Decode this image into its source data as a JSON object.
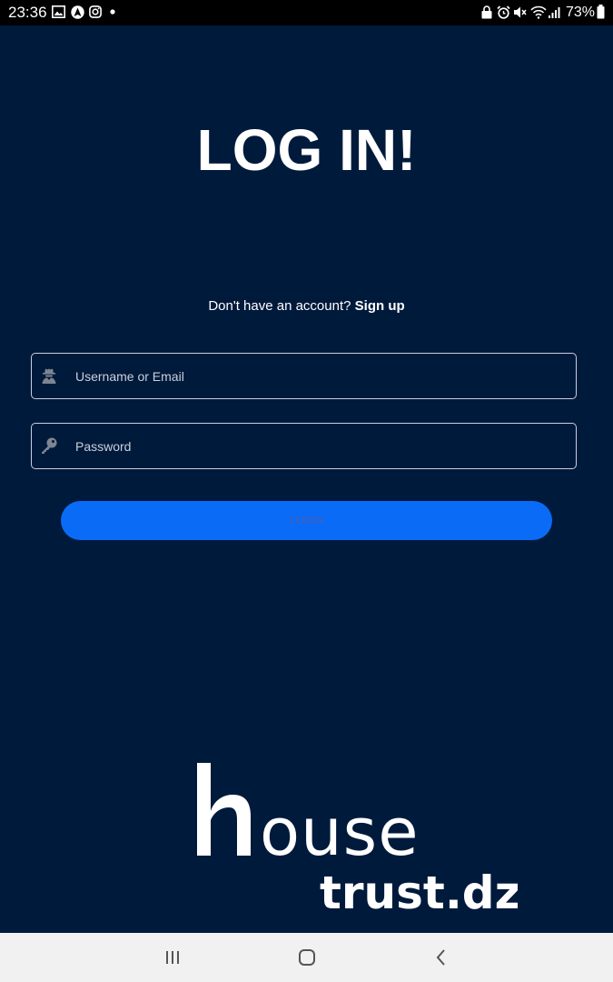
{
  "status_bar": {
    "time": "23:36",
    "battery_percent": "73%",
    "left_icons": [
      "gallery-icon",
      "android-auto-icon",
      "instagram-icon",
      "dot-icon"
    ],
    "right_icons": [
      "lock-icon",
      "alarm-icon",
      "mute-icon",
      "wifi-icon",
      "signal-icon",
      "battery-icon"
    ]
  },
  "login": {
    "title": "LOG IN!",
    "signup_prompt": "Don't have an account?",
    "signup_link": "Sign up",
    "username_placeholder": "Username or Email",
    "password_placeholder": "Password",
    "login_button": "LOGIN"
  },
  "logo": {
    "text": "house trust.dz"
  },
  "nav_bar": {
    "icons": [
      "recent-apps-icon",
      "home-icon",
      "back-icon"
    ]
  },
  "colors": {
    "background": "#001a3c",
    "status_bar": "#000000",
    "button": "#0a6bf7",
    "button_text": "#4a5fb2",
    "field_border": "#c9cfd8",
    "nav_bar": "#f1f1f1"
  }
}
